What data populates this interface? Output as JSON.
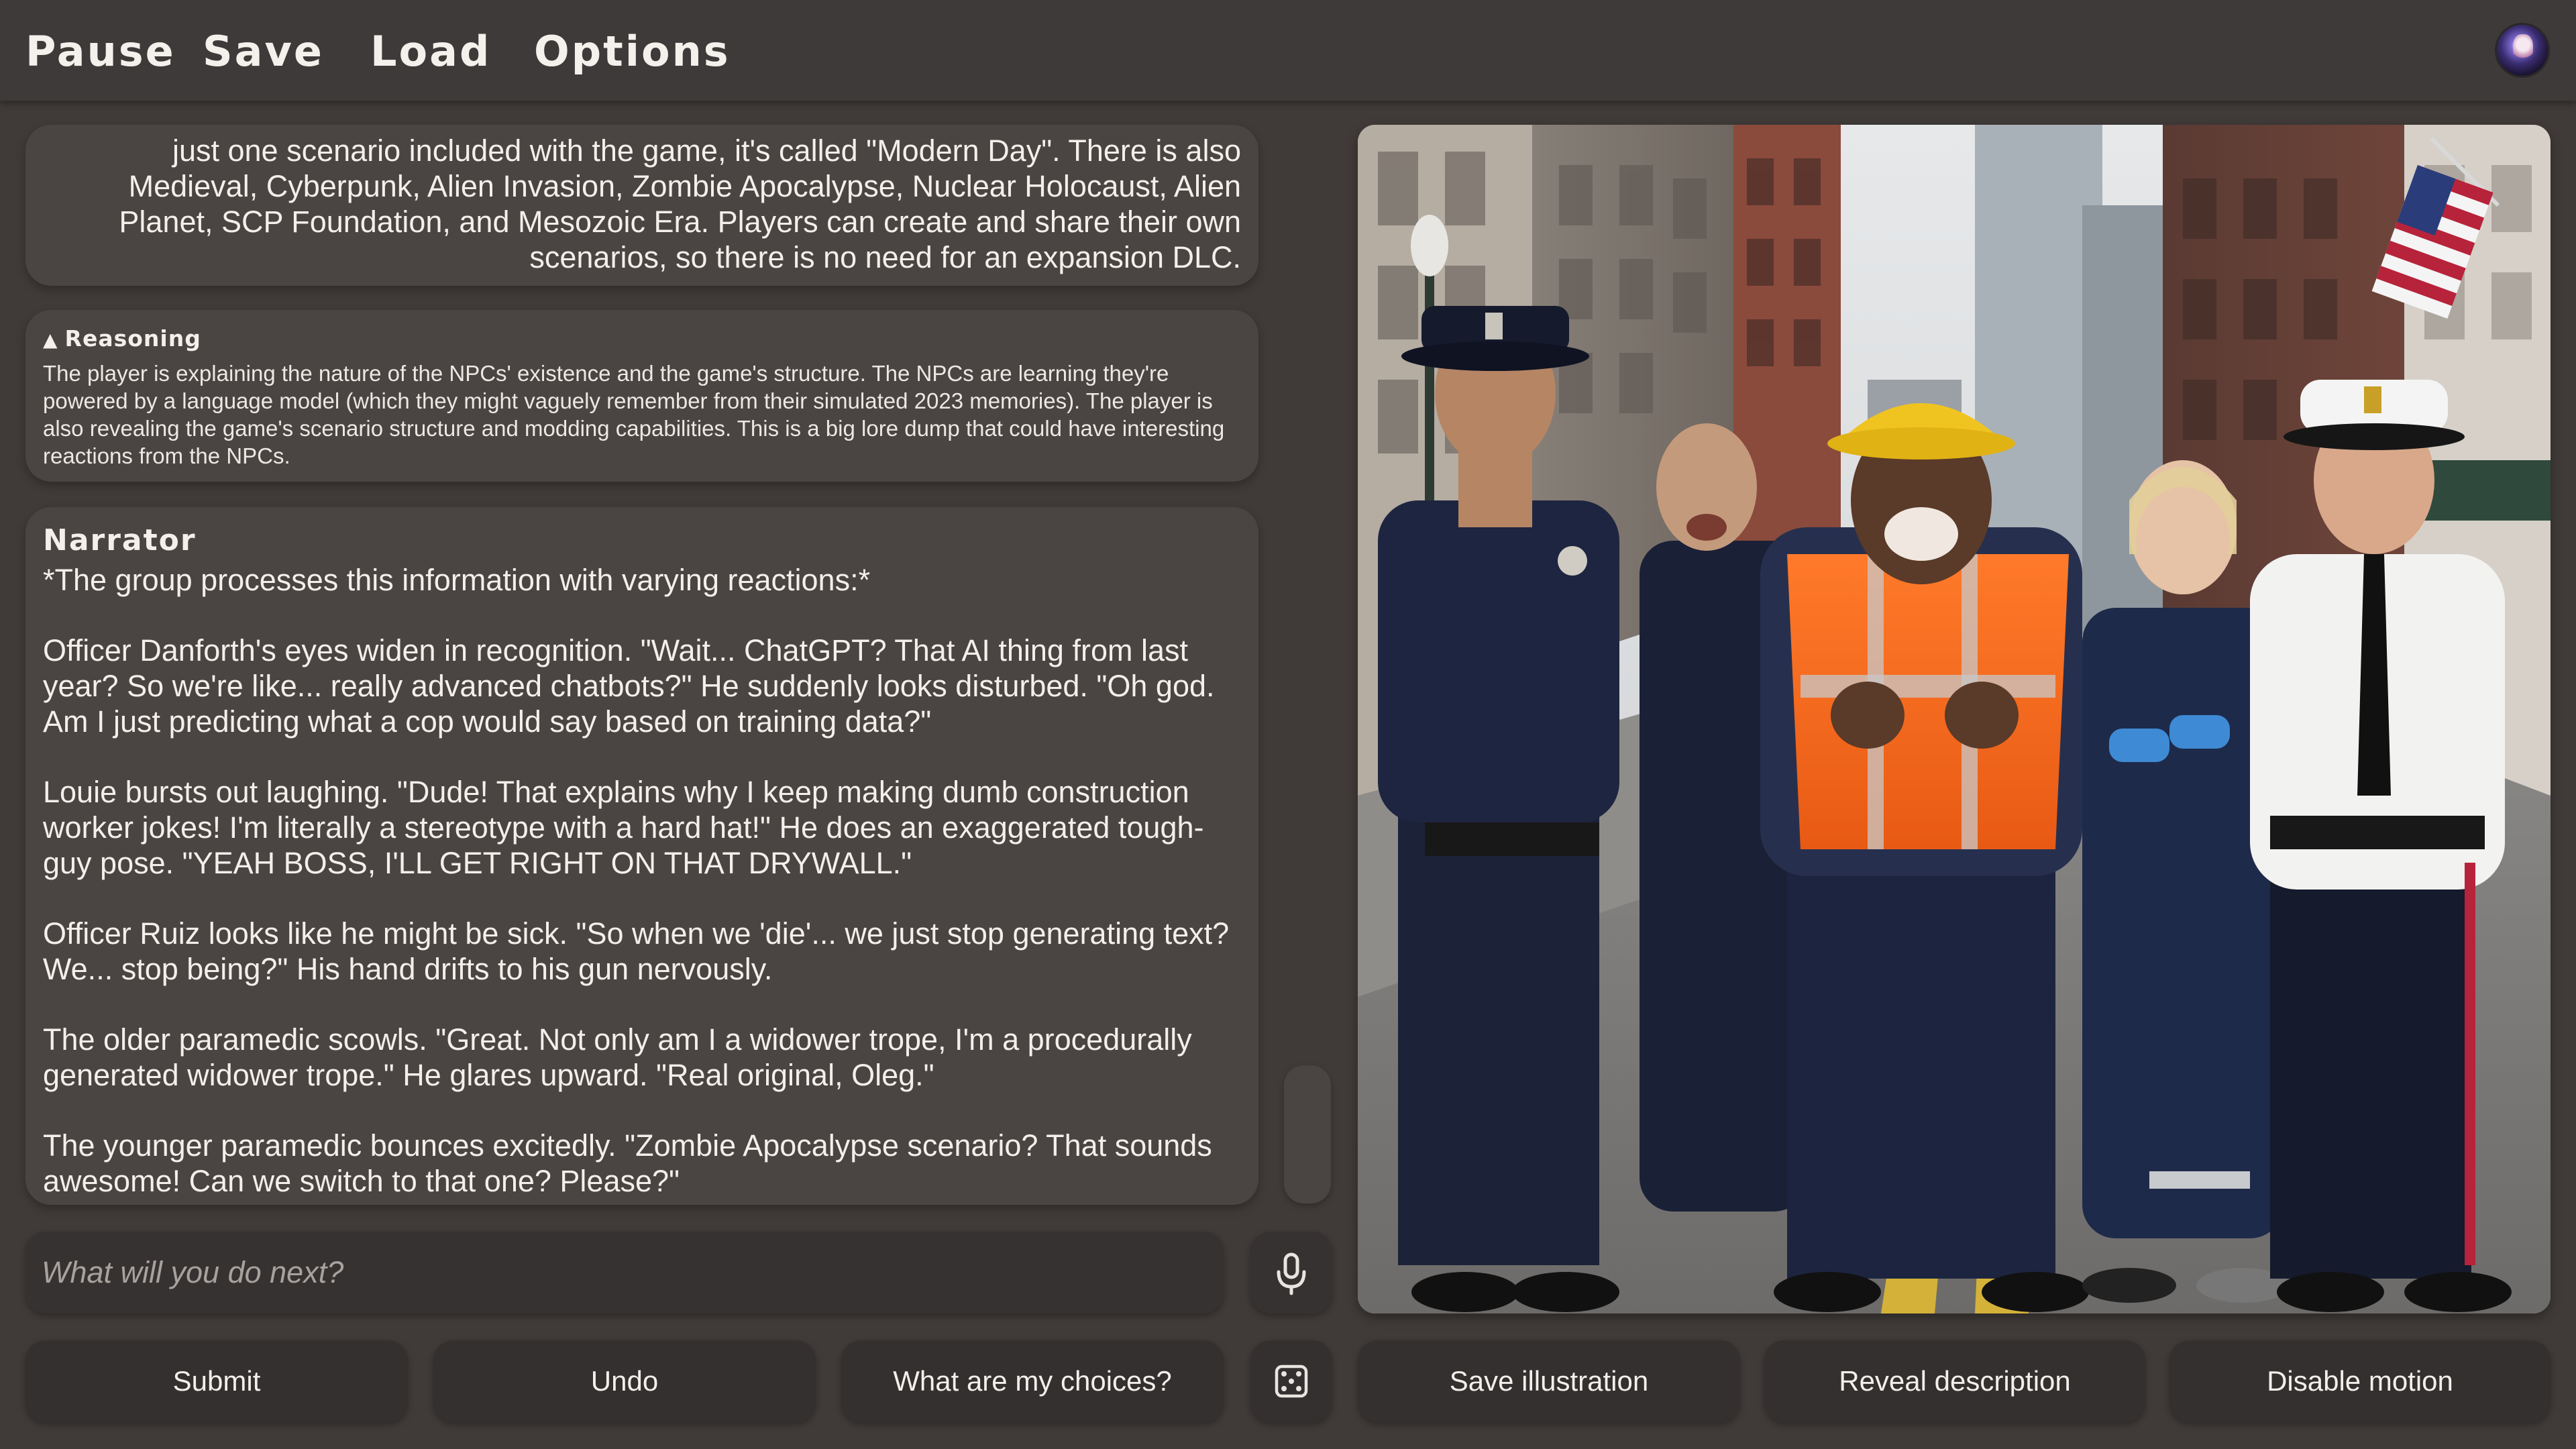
{
  "menu": {
    "pause": "Pause",
    "save": "Save",
    "load": "Load",
    "options": "Options"
  },
  "story": {
    "previous_message": "just one scenario included with the game, it's called \"Modern Day\". There is also Medieval, Cyberpunk, Alien Invasion, Zombie Apocalypse, Nuclear Holocaust, Alien Planet, SCP Foundation, and Mesozoic Era. Players can create and share their own scenarios, so there is no need for an expansion DLC.",
    "reasoning": {
      "heading": "Reasoning",
      "text": "The player is explaining the nature of the NPCs' existence and the game's structure. The NPCs are learning they're powered by a language model (which they might vaguely remember from their simulated 2023 memories). The player is also revealing the game's scenario structure and modding capabilities. This is a big lore dump that could have interesting reactions from the NPCs."
    },
    "narrator": {
      "speaker": "Narrator",
      "paragraphs": [
        "*The group processes this information with varying reactions:*",
        "Officer Danforth's eyes widen in recognition. \"Wait... ChatGPT? That AI thing from last year? So we're like... really advanced chatbots?\" He suddenly looks disturbed. \"Oh god. Am I just predicting what a cop would say based on training data?\"",
        "Louie bursts out laughing. \"Dude! That explains why I keep making dumb construction worker jokes! I'm literally a stereotype with a hard hat!\" He does an exaggerated tough-guy pose. \"YEAH BOSS, I'LL GET RIGHT ON THAT DRYWALL.\"",
        "Officer Ruiz looks like he might be sick. \"So when we 'die'... we just stop generating text? We... stop being?\" His hand drifts to his gun nervously.",
        "The older paramedic scowls. \"Great. Not only am I a widower trope, I'm a procedurally generated widower trope.\" He glares upward. \"Real original, Oleg.\"",
        "The younger paramedic bounces excitedly. \"Zombie Apocalypse scenario? That sounds awesome! Can we switch to that one? Please?\""
      ]
    }
  },
  "input": {
    "placeholder": "What will you do next?",
    "value": ""
  },
  "actions": {
    "submit": "Submit",
    "undo": "Undo",
    "choices": "What are my choices?",
    "save_illustration": "Save illustration",
    "reveal_description": "Reveal description",
    "disable_motion": "Disable motion"
  },
  "icons": {
    "mic": "microphone-icon",
    "dice": "dice-icon",
    "avatar": "user-avatar",
    "reasoning_toggle": "triangle-up-icon"
  }
}
